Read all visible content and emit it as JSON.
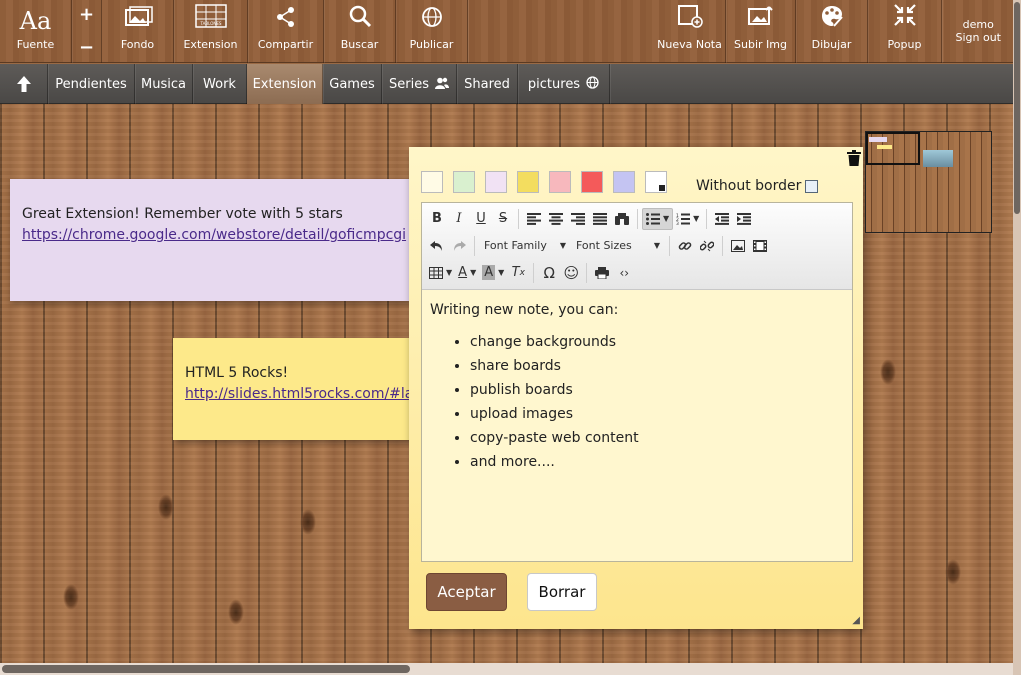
{
  "toolbar": {
    "font_label": "Fuente",
    "font_icon": "Aa",
    "increase_icon": "+",
    "decrease_icon": "−",
    "background_label": "Fondo",
    "extension_label": "Extension",
    "extension_icon_text": "TABLONES",
    "share_label": "Compartir",
    "search_label": "Buscar",
    "publish_label": "Publicar",
    "new_note_label": "Nueva Nota",
    "upload_label": "Subir Img",
    "draw_label": "Dibujar",
    "popup_label": "Popup"
  },
  "user": {
    "name": "demo",
    "signout": "Sign out"
  },
  "tabs": [
    {
      "label": "Pendientes"
    },
    {
      "label": "Musica"
    },
    {
      "label": "Work"
    },
    {
      "label": "Extension",
      "active": true
    },
    {
      "label": "Games"
    },
    {
      "label": "Series",
      "icon": "users-icon"
    },
    {
      "label": "Shared"
    },
    {
      "label": "pictures",
      "icon": "globe-icon"
    }
  ],
  "notes": [
    {
      "text": "Great Extension! Remember vote with 5 stars",
      "link": "https://chrome.google.com/webstore/detail/goficmpcgi",
      "color": "#e7d9ef"
    },
    {
      "text": "HTML 5 Rocks!",
      "link": "http://slides.html5rocks.com/#la",
      "color": "#fde98a"
    }
  ],
  "editor": {
    "swatch_colors": [
      "#fffbe6",
      "#d9f0cf",
      "#f1e2f4",
      "#f3dd5f",
      "#f7b8bd",
      "#f45a5a",
      "#c4c4f2",
      "#ffffff"
    ],
    "without_border_label": "Without border",
    "font_family_label": "Font Family",
    "font_sizes_label": "Font Sizes",
    "content_intro": "Writing new note, you can:",
    "content_items": [
      "change backgrounds",
      "share boards",
      "publish boards",
      "upload images",
      "copy-paste web content",
      "and more...."
    ],
    "accept_label": "Aceptar",
    "clear_label": "Borrar"
  }
}
